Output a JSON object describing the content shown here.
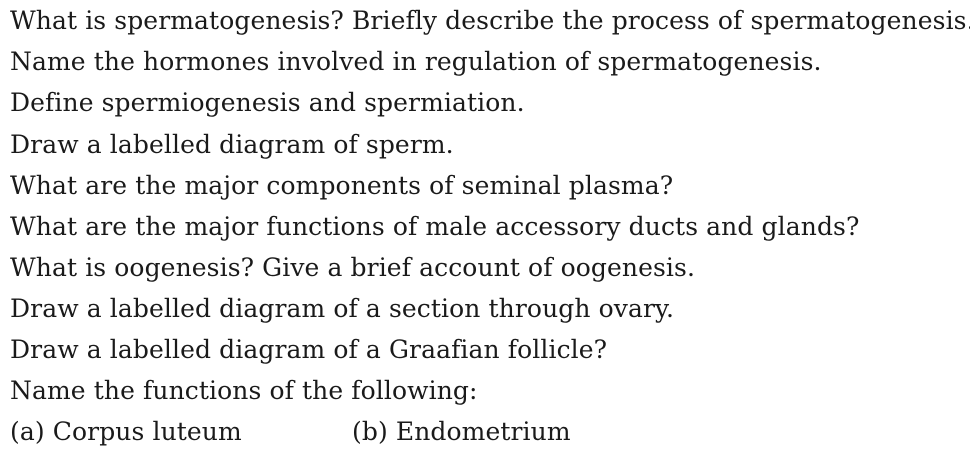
{
  "questions": [
    "What is spermatogenesis? Briefly describe the process of spermatogenesis.",
    "Name the hormones involved in regulation of spermatogenesis.",
    "Define spermiogenesis and spermiation.",
    "Draw a labelled diagram of sperm.",
    "What are the major components of seminal plasma?",
    "What are the major functions of male accessory ducts and glands?",
    "What is oogenesis? Give a brief account of oogenesis.",
    "Draw a labelled diagram of a section through ovary.",
    "Draw a labelled diagram of a Graafian follicle?",
    "Name the functions of the following:"
  ],
  "options": {
    "a": "(a) Corpus luteum",
    "b": "(b) Endometrium"
  }
}
